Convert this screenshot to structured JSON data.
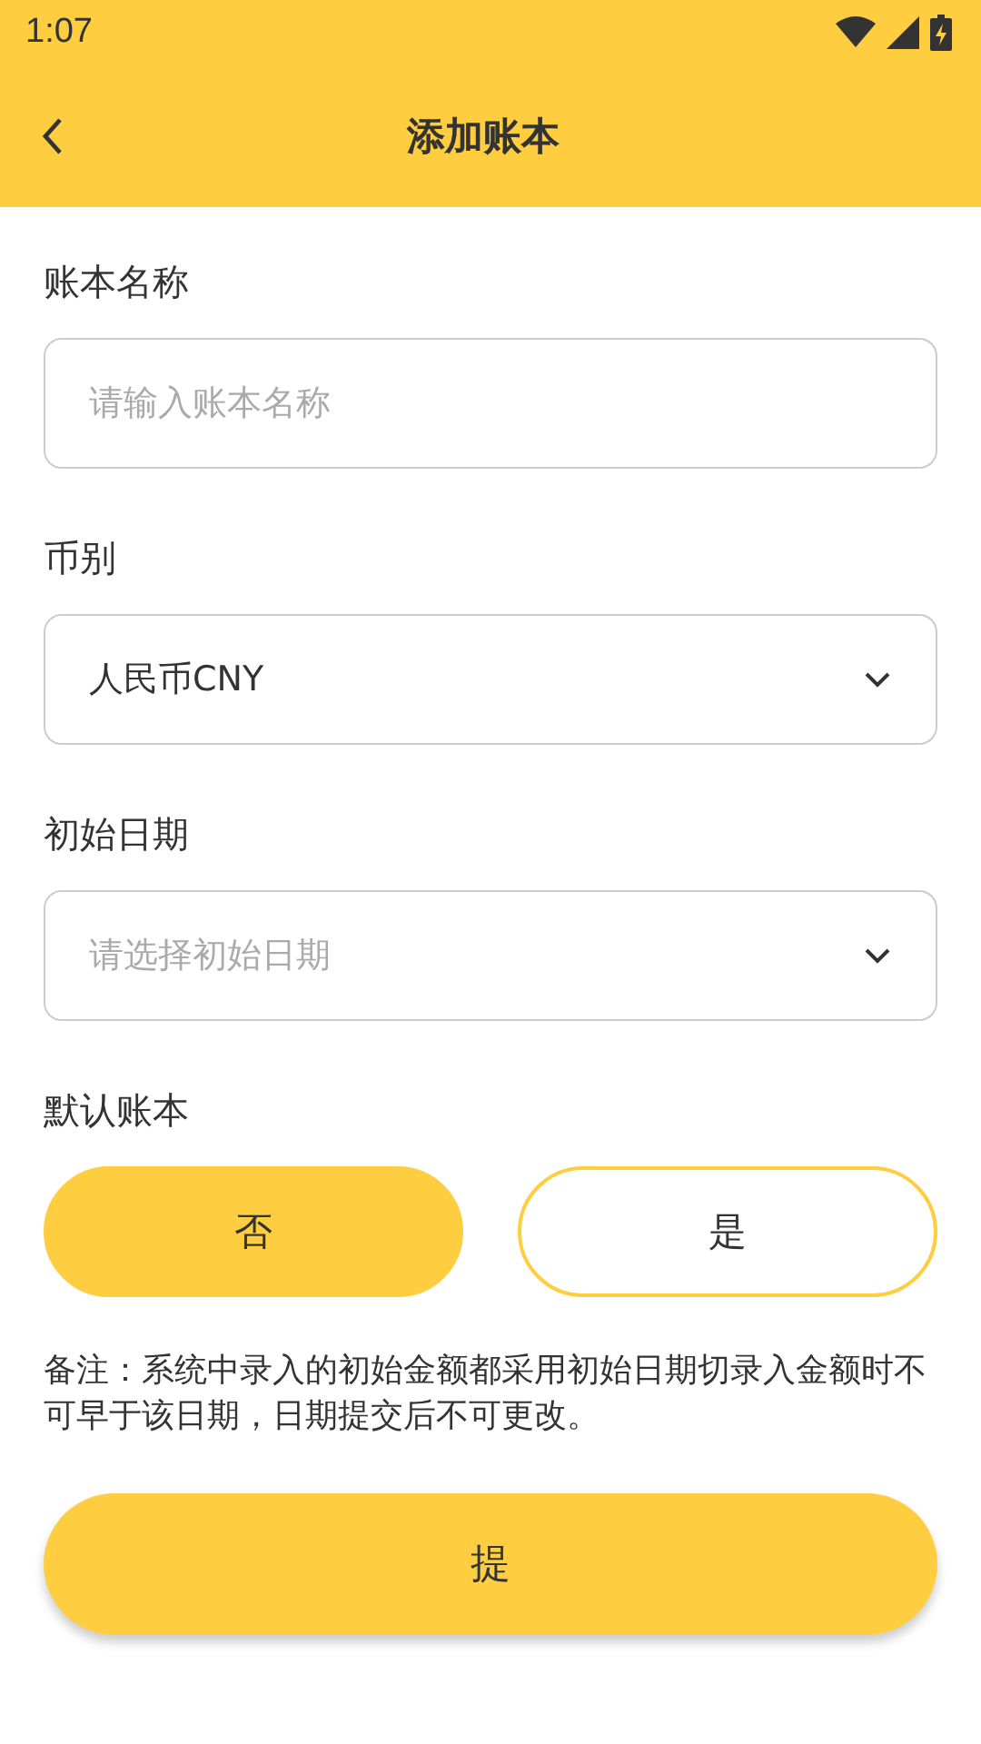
{
  "status_bar": {
    "time": "1:07"
  },
  "header": {
    "title": "添加账本"
  },
  "fields": [
    {
      "kind": "text",
      "label": "账本名称",
      "placeholder": "请输入账本名称"
    },
    {
      "kind": "select",
      "label": "币别",
      "value": "人民币CNY"
    },
    {
      "kind": "select",
      "label": "初始日期",
      "placeholder": "请选择初始日期"
    }
  ],
  "default_book": {
    "label": "默认账本",
    "options": [
      {
        "label": "否",
        "selected": true
      },
      {
        "label": "是",
        "selected": false
      }
    ]
  },
  "note": "备注：系统中录入的初始金额都采用初始日期切录入金额时不可早于该日期，日期提交后不可更改。",
  "submit_button": "提"
}
